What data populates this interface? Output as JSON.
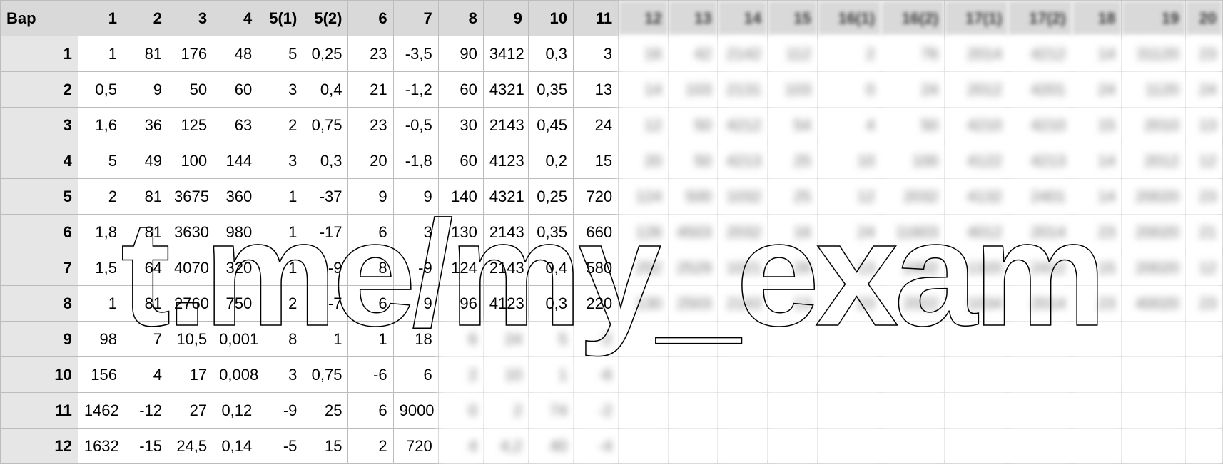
{
  "chart_data": {
    "type": "table",
    "title": "Вар",
    "column_headers": [
      "Вар",
      "1",
      "2",
      "3",
      "4",
      "5(1)",
      "5(2)",
      "6",
      "7",
      "8",
      "9",
      "10",
      "11"
    ],
    "rows": [
      [
        "1",
        "1",
        "81",
        "176",
        "48",
        "5",
        "0,25",
        "23",
        "-3,5",
        "90",
        "3412",
        "0,3",
        "3"
      ],
      [
        "2",
        "0,5",
        "9",
        "50",
        "60",
        "3",
        "0,4",
        "21",
        "-1,2",
        "60",
        "4321",
        "0,35",
        "13"
      ],
      [
        "3",
        "1,6",
        "36",
        "125",
        "63",
        "2",
        "0,75",
        "23",
        "-0,5",
        "30",
        "2143",
        "0,45",
        "24"
      ],
      [
        "4",
        "5",
        "49",
        "100",
        "144",
        "3",
        "0,3",
        "20",
        "-1,8",
        "60",
        "4123",
        "0,2",
        "15"
      ],
      [
        "5",
        "2",
        "81",
        "3675",
        "360",
        "1",
        "-37",
        "9",
        "9",
        "140",
        "4321",
        "0,25",
        "720"
      ],
      [
        "6",
        "1,8",
        "81",
        "3630",
        "980",
        "1",
        "-17",
        "6",
        "3",
        "130",
        "2143",
        "0,35",
        "660"
      ],
      [
        "7",
        "1,5",
        "64",
        "4070",
        "320",
        "1",
        "-9",
        "8",
        "-9",
        "124",
        "2143",
        "0,4",
        "580"
      ],
      [
        "8",
        "1",
        "81",
        "2760",
        "750",
        "2",
        "-7",
        "6",
        "9",
        "96",
        "4123",
        "0,3",
        "220"
      ],
      [
        "9",
        "98",
        "7",
        "10,5",
        "0,001",
        "8",
        "1",
        "1",
        "18",
        "",
        "",
        "",
        ""
      ],
      [
        "10",
        "156",
        "4",
        "17",
        "0,008",
        "3",
        "0,75",
        "-6",
        "6",
        "",
        "",
        "",
        ""
      ],
      [
        "11",
        "1462",
        "-12",
        "27",
        "0,12",
        "-9",
        "25",
        "6",
        "9000",
        "",
        "",
        "",
        ""
      ],
      [
        "12",
        "1632",
        "-15",
        "24,5",
        "0,14",
        "-5",
        "15",
        "2",
        "720",
        "",
        "",
        "",
        ""
      ]
    ],
    "blurred_header_cells": [
      "12",
      "13",
      "14",
      "15",
      "16(1)",
      "16(2)",
      "17(1)",
      "17(2)",
      "18",
      "19",
      "20"
    ],
    "blurred_body": [
      [
        "16",
        "42",
        "2142",
        "112",
        "2",
        "76",
        "2014",
        "4212",
        "14",
        "31120",
        "23"
      ],
      [
        "14",
        "103",
        "2131",
        "103",
        "0",
        "24",
        "2012",
        "4201",
        "24",
        "1120",
        "24"
      ],
      [
        "12",
        "50",
        "4212",
        "54",
        "4",
        "50",
        "4210",
        "4210",
        "15",
        "2010",
        "13"
      ],
      [
        "20",
        "50",
        "4213",
        "25",
        "10",
        "100",
        "4122",
        "4213",
        "14",
        "2012",
        "12"
      ],
      [
        "124",
        "500",
        "1032",
        "25",
        "12",
        "2032",
        "4132",
        "2401",
        "14",
        "20020",
        "23"
      ],
      [
        "126",
        "4503",
        "2032",
        "16",
        "24",
        "11603",
        "4012",
        "2014",
        "23",
        "20020",
        "21"
      ],
      [
        "252",
        "2529",
        "1021",
        "26",
        "13",
        "2402",
        "1320",
        "2412",
        "15",
        "20020",
        "12"
      ],
      [
        "130",
        "2503",
        "2143",
        "13",
        "23",
        "2022",
        "1034",
        "2014",
        "23",
        "40020",
        "23"
      ],
      [
        "",
        "",
        "",
        "",
        "",
        "",
        "",
        "",
        "",
        "",
        ""
      ],
      [
        "",
        "",
        "",
        "",
        "",
        "",
        "",
        "",
        "",
        "",
        ""
      ],
      [
        "",
        "",
        "",
        "",
        "",
        "",
        "",
        "",
        "",
        "",
        ""
      ],
      [
        "",
        "",
        "",
        "",
        "",
        "",
        "",
        "",
        "",
        "",
        ""
      ]
    ],
    "blurred_row_tail_cols8to11": [
      [
        "6",
        "24",
        "5",
        "-2"
      ],
      [
        "2",
        "10",
        "1",
        "-6"
      ],
      [
        "0",
        "2",
        "74",
        "-2"
      ],
      [
        "4",
        "4,2",
        "40",
        "-4"
      ]
    ]
  },
  "colwidths": {
    "c0": 100,
    "clear": 58,
    "b": [
      64,
      64,
      64,
      64,
      82,
      82,
      82,
      82,
      64,
      64,
      64
    ]
  },
  "watermark": "t.me/my_exam"
}
